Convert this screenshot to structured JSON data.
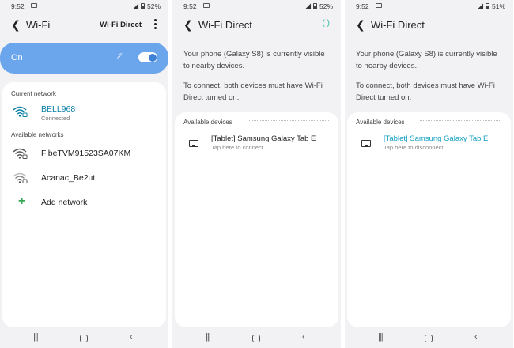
{
  "screens": [
    {
      "status": {
        "time": "9:52",
        "battery": "52%"
      },
      "header": {
        "title": "Wi-Fi",
        "action": "Wi-Fi Direct"
      },
      "toggle": {
        "label": "On",
        "state": "on"
      },
      "current_network_label": "Current network",
      "current_network": {
        "name": "BELL968",
        "status": "Connected"
      },
      "available_networks_label": "Available networks",
      "available_networks": [
        {
          "name": "FibeTVM91523SA07KM"
        },
        {
          "name": "Acanac_Be2ut"
        }
      ],
      "add_network_label": "Add network"
    },
    {
      "status": {
        "time": "9:52",
        "battery": "52%"
      },
      "header": {
        "title": "Wi-Fi Direct"
      },
      "description_1": "Your phone (Galaxy S8) is currently visible to nearby devices.",
      "description_2": "To connect, both devices must have Wi-Fi Direct turned on.",
      "available_devices_label": "Available devices",
      "device": {
        "name": "[Tablet] Samsung Galaxy Tab E",
        "action": "Tap here to connect."
      }
    },
    {
      "status": {
        "time": "9:52",
        "battery": "51%"
      },
      "header": {
        "title": "Wi-Fi Direct"
      },
      "description_1": "Your phone (Galaxy S8) is currently visible to nearby devices.",
      "description_2": "To connect, both devices must have Wi-Fi Direct turned on.",
      "available_devices_label": "Available devices",
      "device": {
        "name": "[Tablet] Samsung Galaxy Tab E",
        "action": "Tap here to disconnect."
      }
    }
  ],
  "icons": {
    "wifi": "wifi-icon",
    "wifi_locked": "wifi-lock-icon",
    "tablet": "tablet-icon",
    "add": "plus-icon",
    "back": "back-arrow-icon",
    "menu": "more-options-icon"
  },
  "colors": {
    "toggle_bar": "#6ba6ec",
    "connected_network": "#0b80a7",
    "connected_device": "#15a0c4",
    "add_icon": "#36a852"
  }
}
